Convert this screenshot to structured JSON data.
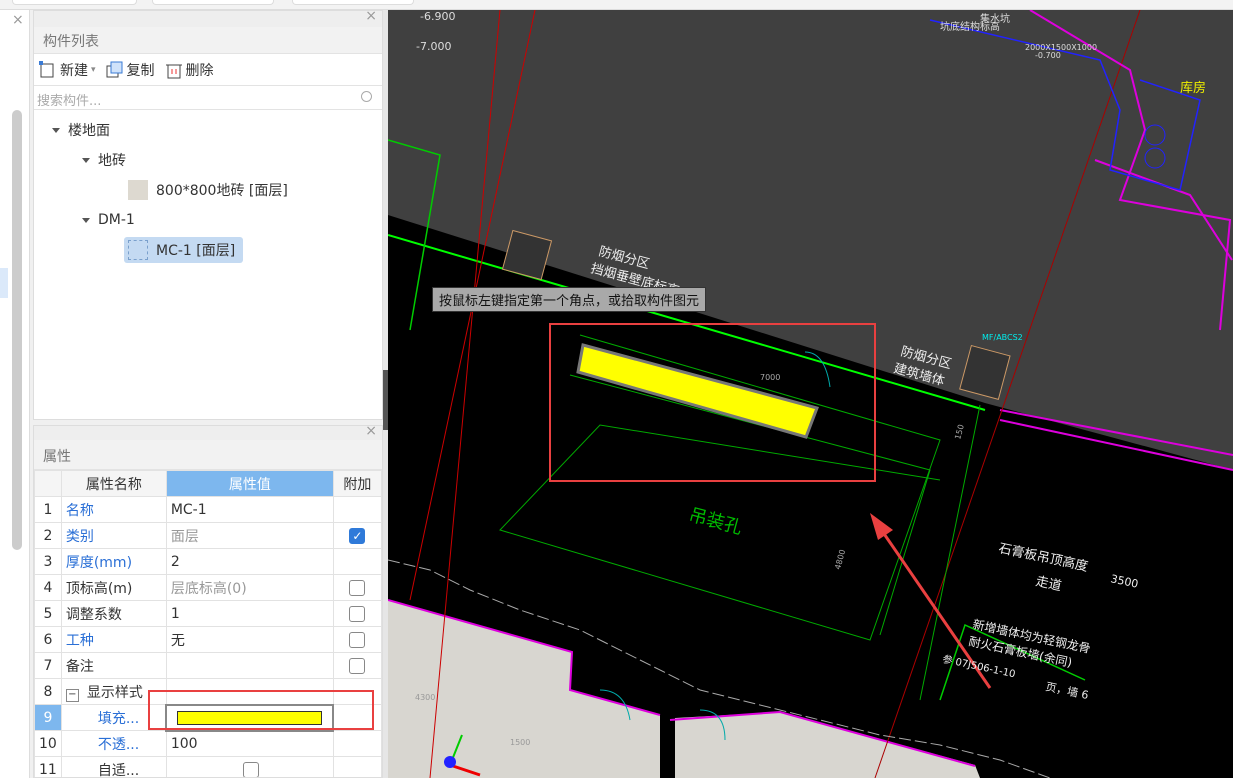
{
  "component_list": {
    "title": "构件列表",
    "toolbar": {
      "new_label": "新建",
      "copy_label": "复制",
      "delete_label": "删除"
    },
    "search_placeholder": "搜索构件...",
    "tree": [
      {
        "label": "楼地面",
        "level": 0
      },
      {
        "label": "地砖",
        "level": 1
      },
      {
        "label": "800*800地砖 [面层]",
        "level": 2
      },
      {
        "label": "DM-1",
        "level": 1
      },
      {
        "label": "MC-1 [面层]",
        "level": 2,
        "selected": true
      }
    ]
  },
  "properties": {
    "title": "属性",
    "headers": [
      "属性名称",
      "属性值",
      "附加"
    ],
    "rows": [
      {
        "idx": "1",
        "name": "名称",
        "value": "MC-1",
        "check": null
      },
      {
        "idx": "2",
        "name": "类别",
        "value": "面层",
        "check": true
      },
      {
        "idx": "3",
        "name": "厚度(mm)",
        "value": "2",
        "check": null
      },
      {
        "idx": "4",
        "name": "顶标高(m)",
        "value": "层底标高(0)",
        "check": false
      },
      {
        "idx": "5",
        "name": "调整系数",
        "value": "1",
        "check": false
      },
      {
        "idx": "6",
        "name": "工种",
        "value": "无",
        "check": false
      },
      {
        "idx": "7",
        "name": "备注",
        "value": "",
        "check": false
      },
      {
        "idx": "8",
        "name": "显示样式",
        "value": "",
        "check": null
      },
      {
        "idx": "9",
        "name": "填充...",
        "value": "",
        "check": null
      },
      {
        "idx": "10",
        "name": "不透...",
        "value": "100",
        "check": null
      },
      {
        "idx": "11",
        "name": "自适...",
        "value": "",
        "check": null
      }
    ],
    "fill_color": "#ffff00"
  },
  "canvas": {
    "tooltip": "按鼠标左键指定第一个角点，或拾取构件图元",
    "texts": {
      "elev1": "-6.900",
      "elev2": "-7.000",
      "pit": "集水坑",
      "pit_note": "坑底结构标高",
      "pit_size": "2000X1500X1000",
      "pit_elev": "-0.700",
      "store": "库房",
      "smoke1a": "防烟分区",
      "smoke1b": "挡烟垂壁底标高",
      "smoke2a": "防烟分区",
      "smoke2b": "建筑墙体",
      "ext": "MF/ABCS2",
      "dim1": "7000",
      "dim2": "4800",
      "dim3": "150",
      "hoist": "吊装孔",
      "ceil1": "石膏板吊顶高度",
      "ceil2": "走道",
      "ceil3": "3500",
      "wall1": "新增墙体均为轻钢龙骨",
      "wall2": "耐火石膏板墙(余同)",
      "ref1": "参 07J506-1-10",
      "ref2": "页，墙 6",
      "d4": "4300",
      "d5": "1500"
    },
    "colors": {
      "grey": "#404040",
      "highlight": "#e94040",
      "yellow": "#ffff00"
    }
  }
}
